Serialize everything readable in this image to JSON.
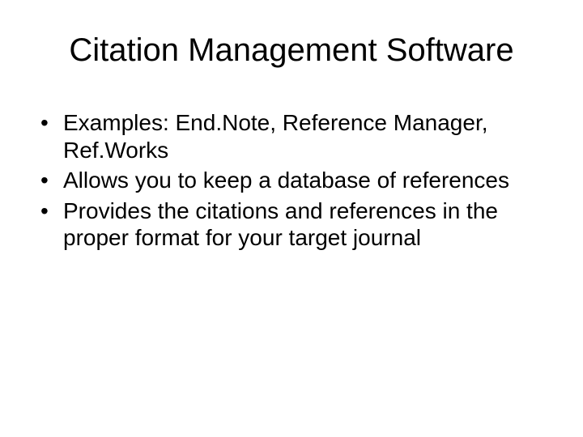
{
  "title": "Citation Management Software",
  "bullets": [
    "Examples: End.Note, Reference Manager, Ref.Works",
    "Allows you to keep a database of references",
    "Provides the citations and references in the proper format for your target journal"
  ]
}
